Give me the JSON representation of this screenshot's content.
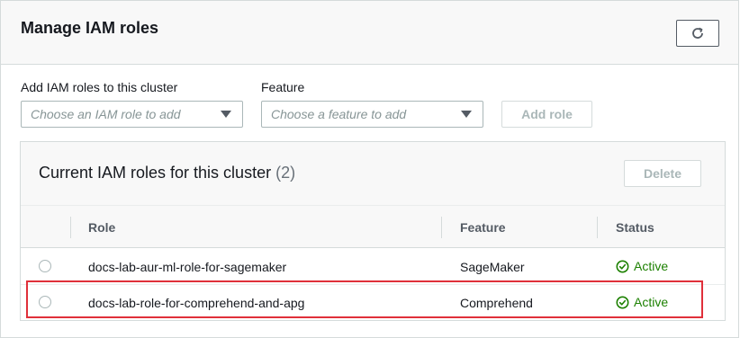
{
  "header": {
    "title": "Manage IAM roles"
  },
  "form": {
    "role_label": "Add IAM roles to this cluster",
    "role_placeholder": "Choose an IAM role to add",
    "feature_label": "Feature",
    "feature_placeholder": "Choose a feature to add",
    "add_role_label": "Add role"
  },
  "table": {
    "title": "Current IAM roles for this cluster",
    "count": "(2)",
    "delete_label": "Delete",
    "columns": [
      "Role",
      "Feature",
      "Status"
    ],
    "rows": [
      {
        "role": "docs-lab-aur-ml-role-for-sagemaker",
        "feature": "SageMaker",
        "status": "Active"
      },
      {
        "role": "docs-lab-role-for-comprehend-and-apg",
        "feature": "Comprehend",
        "status": "Active"
      }
    ]
  },
  "colors": {
    "status_active": "#1d8102",
    "highlight": "#e0303a"
  },
  "icons": {
    "refresh": "refresh-icon",
    "status": "check-circle-icon",
    "dropdown": "caret-down-icon"
  }
}
